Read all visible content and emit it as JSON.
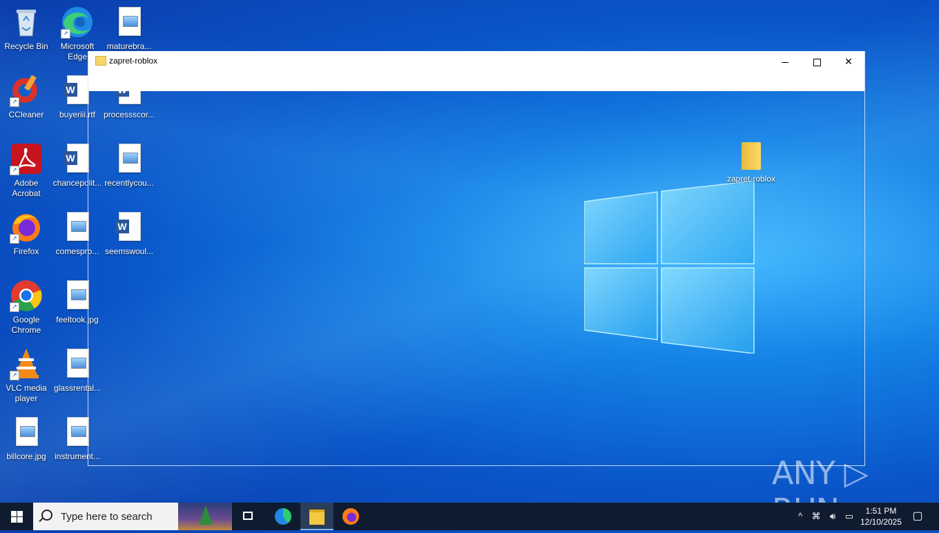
{
  "desktop": {
    "icons": [
      {
        "label": "Recycle Bin",
        "icon": "recycle-bin-icon"
      },
      {
        "label": "Microsoft Edge",
        "icon": "edge-icon"
      },
      {
        "label": "maturebra...",
        "icon": "image-file-icon"
      },
      {
        "label": "CCleaner",
        "icon": "ccleaner-icon"
      },
      {
        "label": "buyeriii.rtf",
        "icon": "word-doc-icon"
      },
      {
        "label": "processscor...",
        "icon": "word-doc-icon"
      },
      {
        "label": "Adobe Acrobat",
        "icon": "acrobat-icon"
      },
      {
        "label": "chancepolit...",
        "icon": "word-doc-icon"
      },
      {
        "label": "recentlycou...",
        "icon": "image-file-icon"
      },
      {
        "label": "Firefox",
        "icon": "firefox-icon"
      },
      {
        "label": "comespro...",
        "icon": "image-file-icon"
      },
      {
        "label": "seemswoul...",
        "icon": "word-doc-icon"
      },
      {
        "label": "Google Chrome",
        "icon": "chrome-icon"
      },
      {
        "label": "feeltook.jpg",
        "icon": "image-file-icon"
      },
      {
        "label": "VLC media player",
        "icon": "vlc-icon"
      },
      {
        "label": "glassrental...",
        "icon": "image-file-icon"
      },
      {
        "label": "billcore.jpg",
        "icon": "image-file-icon"
      },
      {
        "label": "instrument...",
        "icon": "image-file-icon"
      }
    ],
    "dragged_folder": {
      "label": "zapret-roblox"
    },
    "watermark": "ANY ▷ RUN"
  },
  "window": {
    "title": "zapret-roblox",
    "controls": {
      "minimize": "minimize",
      "maximize": "maximize",
      "close": "✕"
    }
  },
  "taskbar": {
    "search_placeholder": "Type here to search",
    "pinned": [
      "task-view",
      "microsoft-edge",
      "file-explorer",
      "firefox"
    ],
    "active": "file-explorer",
    "tray": {
      "chevron": "^",
      "time": "1:51 PM",
      "date": "12/10/2025"
    }
  }
}
